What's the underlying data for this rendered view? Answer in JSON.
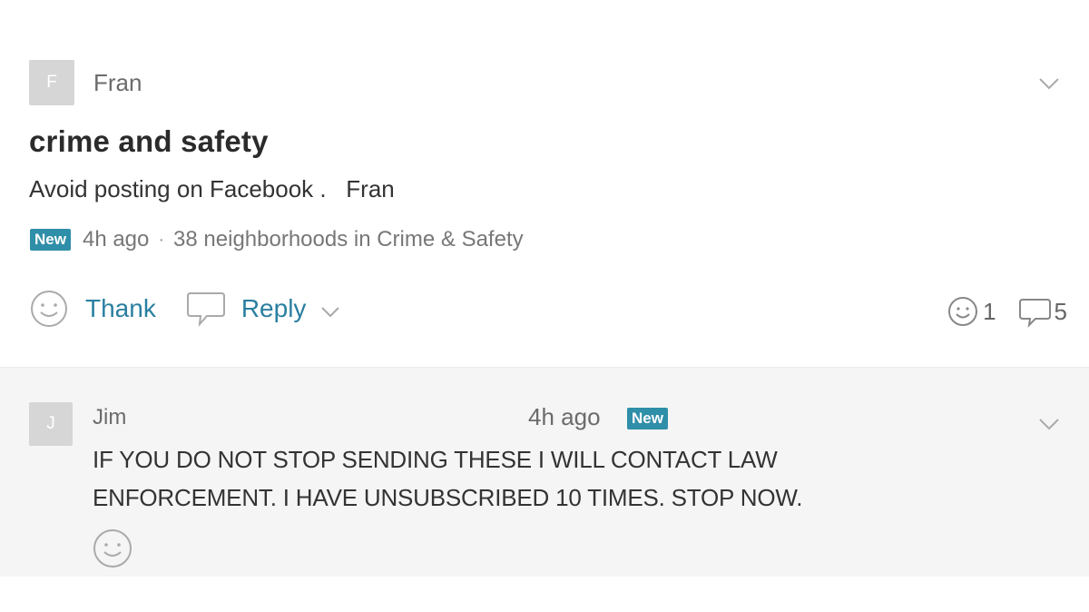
{
  "post": {
    "author_initial": "F",
    "author_name": "Fran",
    "title": "crime and safety",
    "body": "Avoid posting on Facebook .   Fran",
    "badge": "New",
    "time": "4h ago",
    "separator": "·",
    "audience": "38 neighborhoods in Crime & Safety",
    "actions": {
      "thank_label": "Thank",
      "reply_label": "Reply"
    },
    "counts": {
      "thanks": "1",
      "replies": "5"
    },
    "icons": [
      "smiley-icon",
      "speech-bubble-icon",
      "chevron-down-icon"
    ]
  },
  "reply": {
    "author_initial": "J",
    "author_name": "Jim",
    "time": "4h ago",
    "badge": "New",
    "text": "IF YOU DO NOT STOP SENDING THESE I WILL CONTACT LAW ENFORCEMENT. I HAVE UNSUBSCRIBED 10 TIMES. STOP NOW."
  },
  "colors": {
    "accent": "#2a7fa0",
    "badge": "#2f8ea8",
    "reply_background": "#f5f5f5",
    "avatar": "#d6d6d6"
  }
}
